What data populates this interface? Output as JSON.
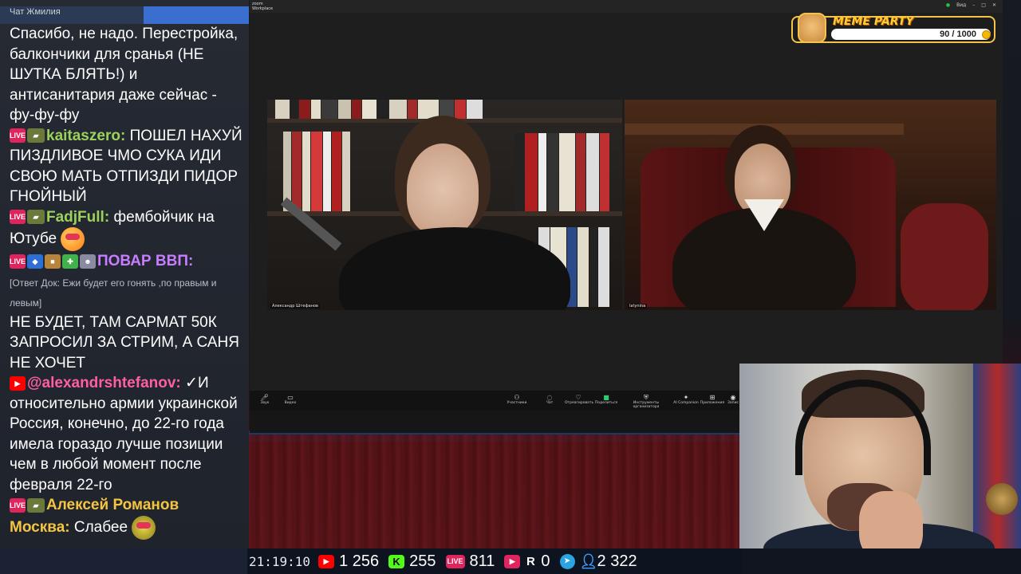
{
  "chat": {
    "title": "Чат Жмилия",
    "messages": [
      {
        "text": "Спасибо, не надо. Перестройка, балкончики для сранья (НЕ ШУТКА БЛЯТЬ!) и антисанитария даже сейчас - фу-фу-фу"
      },
      {
        "badges": [
          "live",
          "tank"
        ],
        "nick": "kaitaszero:",
        "nick_color": "#9cd25a",
        "text": "ПОШЕЛ НАХУЙ ПИЗДЛИВОЕ ЧМО СУКА ИДИ СВОЮ МАТЬ ОТПИЗДИ ПИДОР ГНОЙНЫЙ"
      },
      {
        "badges": [
          "live",
          "tank"
        ],
        "nick": "FadjFull:",
        "nick_color": "#9cd25a",
        "text": "фембойчик на Ютубе"
      },
      {
        "badges": [
          "live",
          "helmet",
          "box",
          "gift",
          "face"
        ],
        "nick": "ПОВАР ВВП:",
        "nick_color": "#c77dff",
        "reply": "[Ответ Док: Ежи будет его гонять ,по правым и левым]",
        "text": "НЕ БУДЕТ, ТАМ САРМАТ 50К ЗАПРОСИЛ ЗА СТРИМ, А САНЯ НЕ ХОЧЕТ"
      },
      {
        "badges": [
          "yt"
        ],
        "nick": "@alexandrshtefanov:",
        "nick_color": "#ff5fa2",
        "text": "✓И относительно армии украинской Россия, конечно, до 22-го года имела гораздо лучше позиции чем в любой момент после февраля 22-го"
      },
      {
        "badges": [
          "live",
          "tank"
        ],
        "nick": "Алексей Романов",
        "nick_color": "#f5c542",
        "text": ""
      },
      {
        "nick": "Москва:",
        "nick_color": "#f5c542",
        "text": "Слабее"
      }
    ]
  },
  "stats": {
    "time": "21:19:10",
    "youtube": "1 256",
    "kick": "255",
    "vkplay": "811",
    "play": "0",
    "rutube": "0",
    "telegram": "",
    "total": "2 322",
    "icons": [
      "youtube-icon",
      "kick-icon",
      "vk-live-icon",
      "play-icon",
      "rutube-icon",
      "telegram-icon",
      "user-icon"
    ]
  },
  "zoom": {
    "app_name": "zoom",
    "app_sub": "Workplace",
    "top_right": "Вид",
    "participants": [
      {
        "name": "Александр Штефанов"
      },
      {
        "name": "latynina"
      }
    ],
    "toolbar": [
      {
        "icon": "mic-icon",
        "label": "Звук"
      },
      {
        "icon": "video-icon",
        "label": "Видео"
      },
      {
        "icon": "participants-icon",
        "label": "Участники"
      },
      {
        "icon": "chat-icon",
        "label": "Чат"
      },
      {
        "icon": "react-icon",
        "label": "Отреагировать"
      },
      {
        "icon": "share-icon",
        "label": "Поделиться"
      },
      {
        "icon": "host-tools-icon",
        "label": "Инструменты организатора"
      },
      {
        "icon": "ai-companion-icon",
        "label": "AI Companion"
      },
      {
        "icon": "apps-icon",
        "label": "Приложения"
      },
      {
        "icon": "record-icon",
        "label": "Запис"
      }
    ]
  },
  "meme_party": {
    "title": "MEME PARTY",
    "progress": "90 / 1000",
    "progress_value": 90,
    "progress_max": 1000
  }
}
